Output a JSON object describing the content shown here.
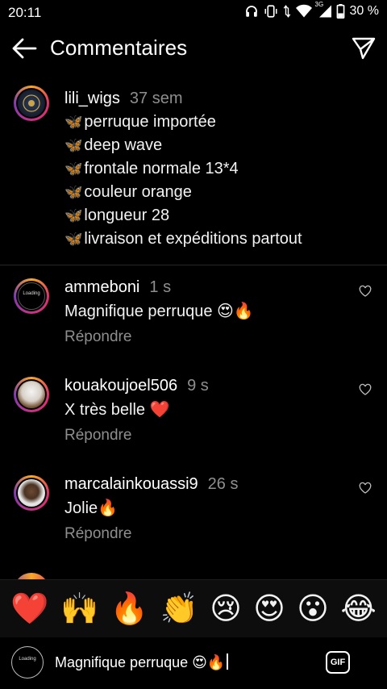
{
  "status_bar": {
    "time": "20:11",
    "network": "3G",
    "battery": "30 %"
  },
  "header": {
    "title": "Commentaires",
    "back_icon": "arrow-left-icon",
    "send_icon": "paper-plane-icon"
  },
  "caption": {
    "username": "lili_wigs",
    "time": "37 sem",
    "lines": [
      "perruque importée",
      "deep wave",
      "frontale normale 13*4",
      "couleur orange",
      "longueur 28",
      "livraison et expéditions partout"
    ],
    "bullet": "🦋"
  },
  "comments": [
    {
      "username": "ammeboni",
      "time": "1 s",
      "text": "Magnifique perruque 😍🔥",
      "reply": "Répondre",
      "avatar_label": "Loading"
    },
    {
      "username": "kouakoujoel506",
      "time": "9 s",
      "text": "X très belle ❤️",
      "reply": "Répondre"
    },
    {
      "username": "marcalainkouassi9",
      "time": "26 s",
      "text": "Jolie🔥",
      "reply": "Répondre"
    }
  ],
  "emoji_bar": [
    "❤️",
    "🙌",
    "🔥",
    "👏",
    "😢",
    "😍",
    "😮",
    "😂"
  ],
  "input": {
    "value": "Magnifique perruque 😍🔥",
    "avatar_label": "Loading",
    "gif_label": "GIF"
  },
  "colors": {
    "background": "#000000",
    "secondary_text": "#8e8e8e",
    "story_ring": "#e1306c"
  }
}
